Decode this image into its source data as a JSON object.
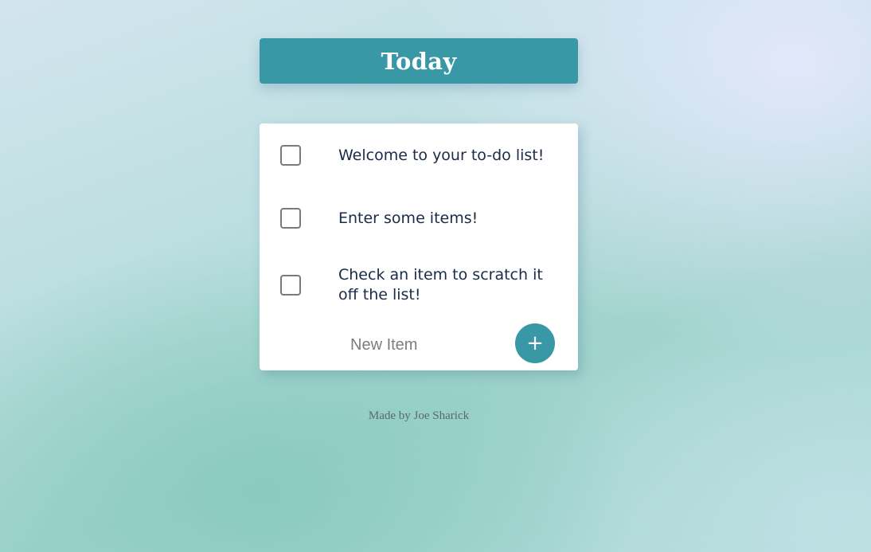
{
  "heading": {
    "title": "Today"
  },
  "list": {
    "items": [
      {
        "label": "Welcome to your to-do list!",
        "checked": false
      },
      {
        "label": "Enter some items!",
        "checked": false
      },
      {
        "label": "Check an item to scratch it off the list!",
        "checked": false
      }
    ],
    "new_item_placeholder": "New Item",
    "add_button_label": "+"
  },
  "footer": {
    "credit": "Made by Joe Sharick"
  },
  "colors": {
    "accent": "#3898a5",
    "item_text": "#1a2b48",
    "card_background": "#ffffff"
  }
}
